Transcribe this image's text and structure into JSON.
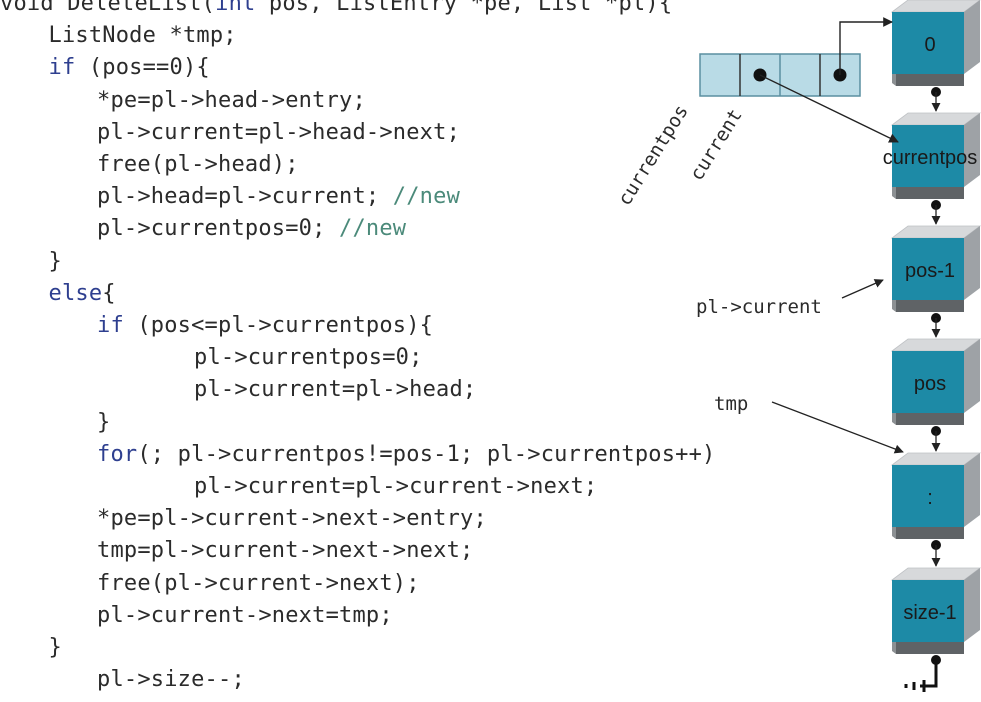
{
  "code": {
    "lines": [
      {
        "indent": 0,
        "parts": [
          {
            "t": "void DeleteList(",
            "k": "kw0"
          },
          {
            "t": "int",
            "k": "kw"
          },
          {
            "t": " pos, ListEntry *pe, List *pl){",
            "k": "n"
          }
        ]
      },
      {
        "indent": 1,
        "parts": [
          {
            "t": "ListNode *tmp;",
            "k": "n"
          }
        ]
      },
      {
        "indent": 1,
        "parts": [
          {
            "t": "if",
            "k": "kw"
          },
          {
            "t": " (pos==0){",
            "k": "n"
          }
        ]
      },
      {
        "indent": 2,
        "parts": [
          {
            "t": "*pe=pl->head->entry;",
            "k": "n"
          }
        ]
      },
      {
        "indent": 2,
        "parts": [
          {
            "t": "pl->current=pl->head->next;",
            "k": "n"
          }
        ]
      },
      {
        "indent": 2,
        "parts": [
          {
            "t": "free(pl->head);",
            "k": "n"
          }
        ]
      },
      {
        "indent": 2,
        "parts": [
          {
            "t": "pl->head=pl->current; ",
            "k": "n"
          },
          {
            "t": "//new",
            "k": "cm"
          }
        ]
      },
      {
        "indent": 2,
        "parts": [
          {
            "t": "pl->currentpos=0; ",
            "k": "n"
          },
          {
            "t": "//new",
            "k": "cm"
          }
        ]
      },
      {
        "indent": 1,
        "parts": [
          {
            "t": "}",
            "k": "n"
          }
        ]
      },
      {
        "indent": 1,
        "parts": [
          {
            "t": "else",
            "k": "kw"
          },
          {
            "t": "{",
            "k": "n"
          }
        ]
      },
      {
        "indent": 2,
        "parts": [
          {
            "t": "if",
            "k": "kw"
          },
          {
            "t": " (pos<=pl->currentpos){",
            "k": "n"
          }
        ]
      },
      {
        "indent": 4,
        "parts": [
          {
            "t": "pl->currentpos=0;",
            "k": "n"
          }
        ]
      },
      {
        "indent": 4,
        "parts": [
          {
            "t": "pl->current=pl->head;",
            "k": "n"
          }
        ]
      },
      {
        "indent": 2,
        "parts": [
          {
            "t": "}",
            "k": "n"
          }
        ]
      },
      {
        "indent": 2,
        "parts": [
          {
            "t": "for",
            "k": "kw"
          },
          {
            "t": "(; pl->currentpos!=pos-1; pl->currentpos++)",
            "k": "n"
          }
        ]
      },
      {
        "indent": 4,
        "parts": [
          {
            "t": "pl->current=pl->current->next;",
            "k": "n"
          }
        ]
      },
      {
        "indent": 2,
        "parts": [
          {
            "t": "*pe=pl->current->next->entry;",
            "k": "n"
          }
        ]
      },
      {
        "indent": 2,
        "parts": [
          {
            "t": "tmp=pl->current->next->next;",
            "k": "n"
          }
        ]
      },
      {
        "indent": 2,
        "parts": [
          {
            "t": "free(pl->current->next);",
            "k": "n"
          }
        ]
      },
      {
        "indent": 2,
        "parts": [
          {
            "t": "pl->current->next=tmp;",
            "k": "n"
          }
        ]
      },
      {
        "indent": 1,
        "parts": [
          {
            "t": "}",
            "k": "n"
          }
        ]
      },
      {
        "indent": 2,
        "parts": [
          {
            "t": "pl->size--;",
            "k": "n"
          }
        ]
      }
    ]
  },
  "diagram": {
    "list_struct_labels": [
      "currentpos",
      "current"
    ],
    "nodes": [
      "0",
      "currentpos",
      "pos-1",
      "pos",
      ":",
      "size-1"
    ],
    "pointer_labels": {
      "current": "pl->current",
      "tmp": "tmp"
    }
  },
  "colors": {
    "node_face": "#1d8aa6",
    "node_top": "#d7d9db",
    "node_side": "#9ea2a6",
    "node_base": "#5f6366",
    "struct_fill": "#b9dbe6",
    "struct_stroke": "#5a8fa0",
    "keyword": "#2e3f8f",
    "comment": "#4b8a7a",
    "text": "#2b2b2b"
  }
}
